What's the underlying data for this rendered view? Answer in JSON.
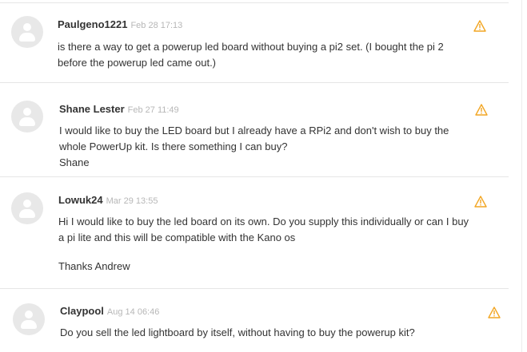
{
  "colors": {
    "flag": "#f2a623",
    "avatar_bg": "#e8e8e8",
    "timestamp": "#b7b7b7",
    "divider": "#e6e6e6",
    "text": "#333333"
  },
  "comments": [
    {
      "author": "Paulgeno1221",
      "timestamp": "Feb 28 17:13",
      "avatar_icon": "user-silhouette",
      "flag_icon": "warning-triangle",
      "lines": [
        "is there a way to get a powerup led board without buying a pi2 set. (I bought the pi 2",
        "before the powerup led came out.)"
      ]
    },
    {
      "author": "Shane Lester",
      "timestamp": "Feb 27 11:49",
      "avatar_icon": "user-silhouette",
      "flag_icon": "warning-triangle",
      "lines": [
        "I would like to buy the LED board but I already have a RPi2 and don't wish to buy the",
        "whole PowerUp kit. Is there something I can buy?",
        "Shane"
      ]
    },
    {
      "author": "Lowuk24",
      "timestamp": "Mar 29 13:55",
      "avatar_icon": "user-silhouette",
      "flag_icon": "warning-triangle",
      "lines": [
        "Hi I would like to buy the led board on its own. Do you supply this individually or can I buy",
        "a pi lite and this will be compatible with the Kano os"
      ],
      "signoff": "Thanks Andrew"
    },
    {
      "author": "Claypool",
      "timestamp": "Aug 14 06:46",
      "avatar_icon": "user-silhouette",
      "flag_icon": "warning-triangle",
      "lines": [
        "Do you sell the led lightboard by itself, without having to buy the powerup kit?"
      ]
    }
  ]
}
